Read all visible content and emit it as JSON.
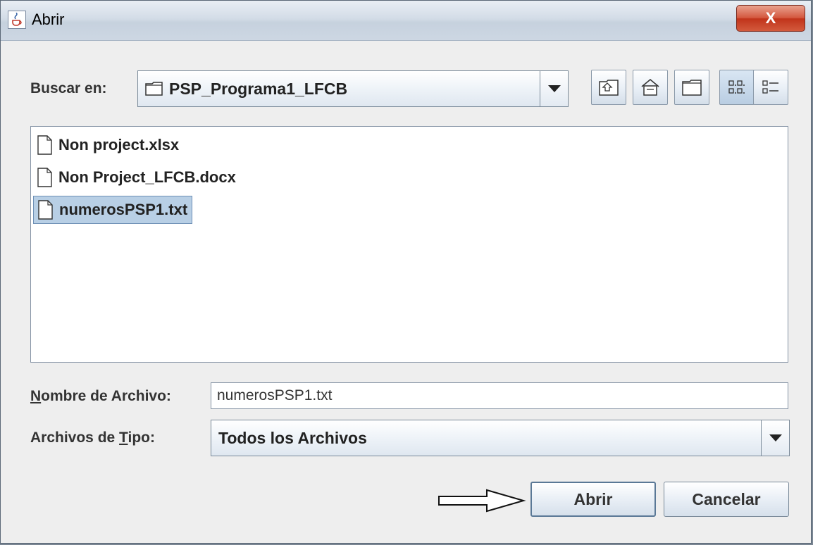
{
  "window": {
    "title": "Abrir",
    "close_glyph": "X"
  },
  "lookin": {
    "label": "Buscar en:",
    "value": "PSP_Programa1_LFCB"
  },
  "toolbar": {
    "icons": [
      "up-folder-icon",
      "home-icon",
      "new-folder-icon",
      "list-view-icon",
      "details-view-icon"
    ]
  },
  "files": [
    {
      "name": "Non project.xlsx",
      "selected": false
    },
    {
      "name": "Non Project_LFCB.docx",
      "selected": false
    },
    {
      "name": "numerosPSP1.txt",
      "selected": true
    }
  ],
  "filename": {
    "label_mnemonic": "N",
    "label_rest": "ombre de Archivo:",
    "value": "numerosPSP1.txt"
  },
  "filetype": {
    "label_prefix": "Archivos de ",
    "label_mnemonic": "T",
    "label_rest": "ipo:",
    "value": "Todos los Archivos"
  },
  "buttons": {
    "open": "Abrir",
    "cancel": "Cancelar"
  },
  "colors": {
    "selection": "#b8cfe5",
    "close_button": "#c1341b"
  }
}
